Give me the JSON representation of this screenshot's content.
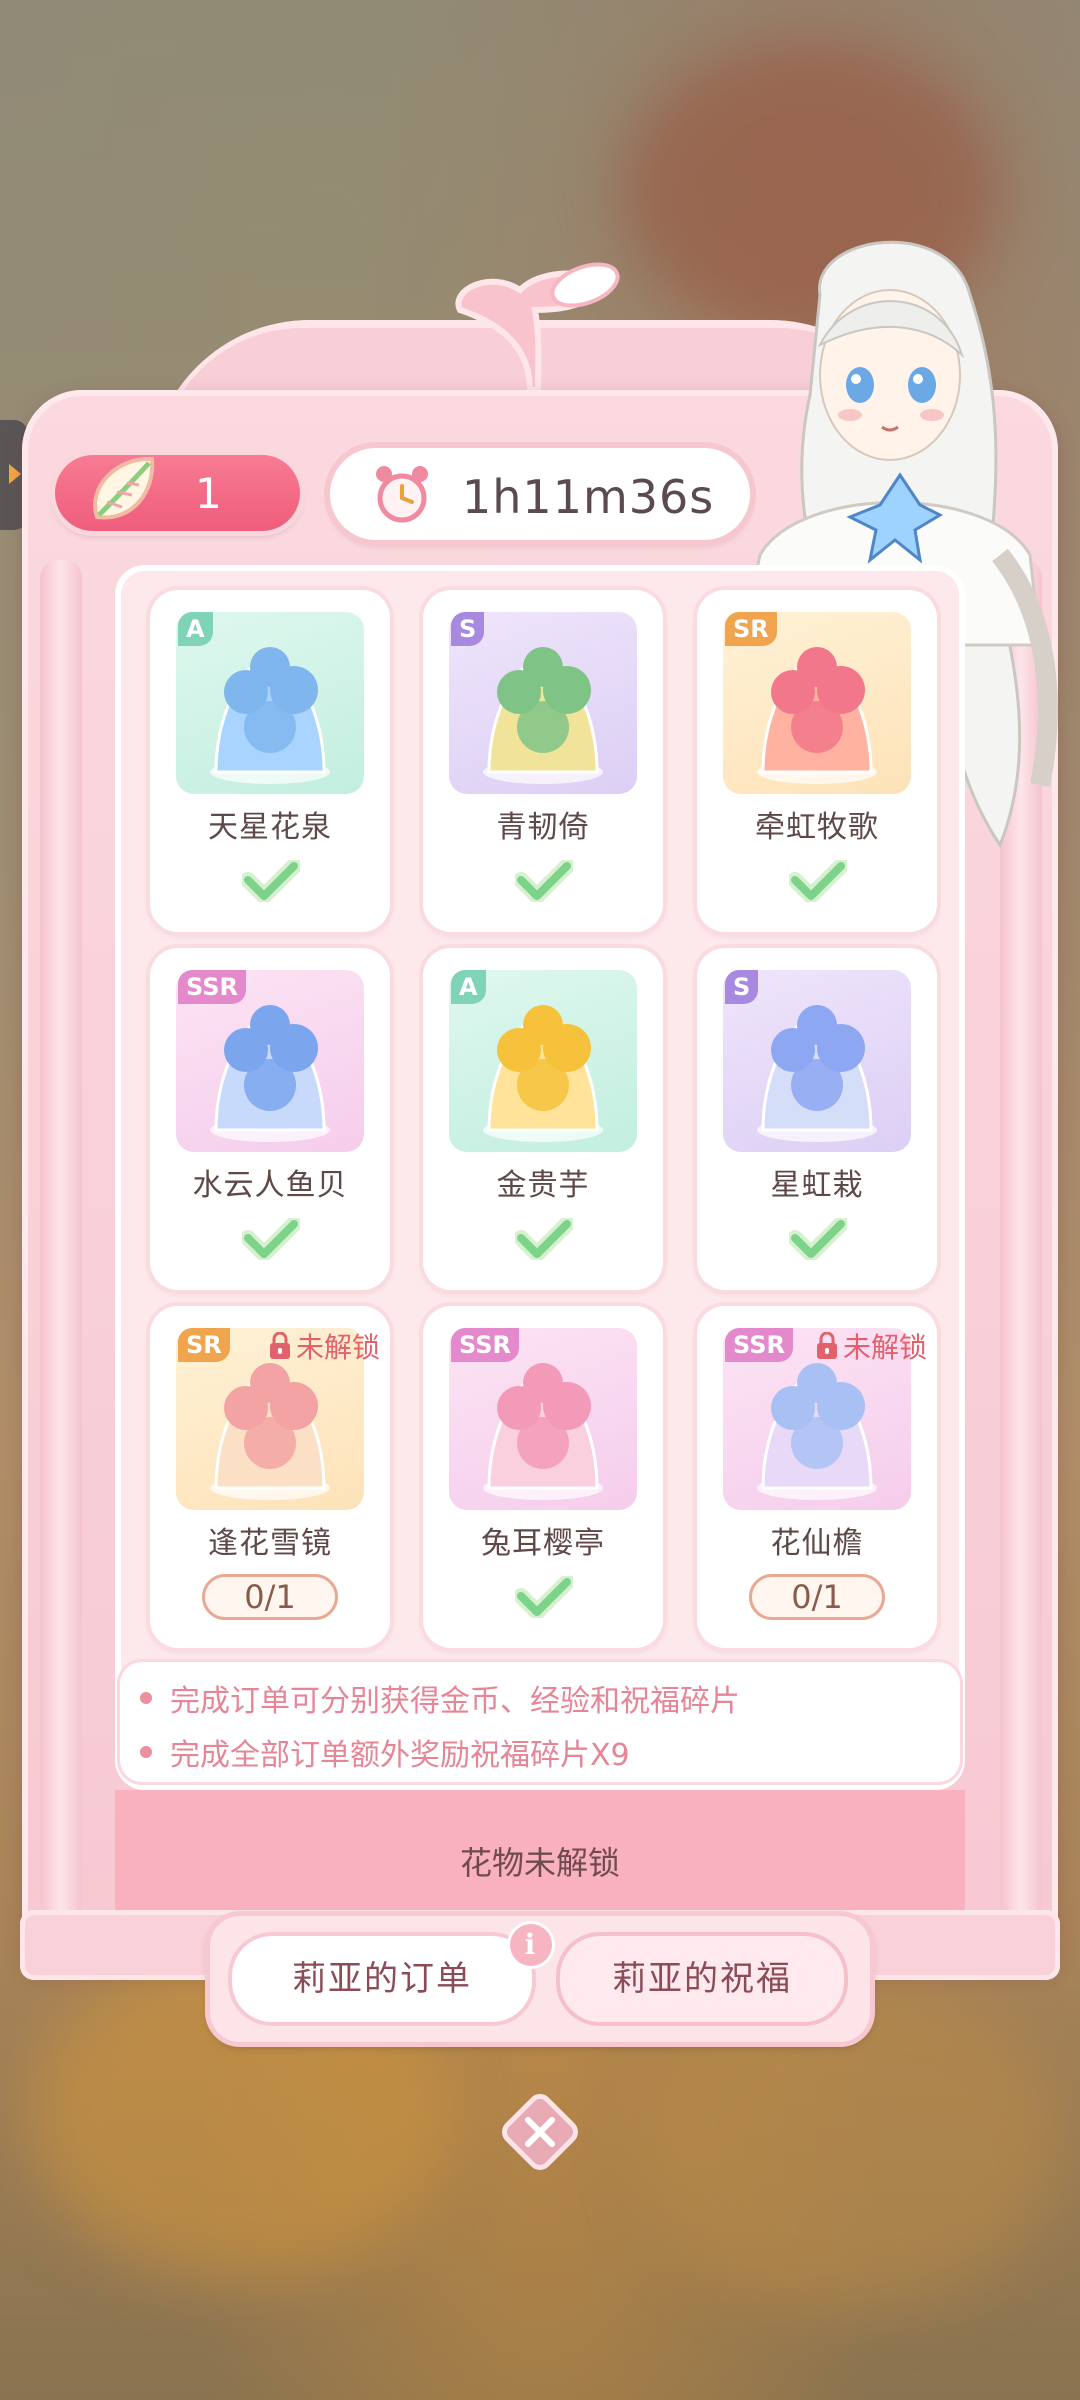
{
  "header": {
    "fragment_count": "1",
    "timer": "1h11m36s"
  },
  "items": [
    {
      "rarity": "A",
      "name": "天星花泉",
      "status": "done"
    },
    {
      "rarity": "S",
      "name": "青韧倚",
      "status": "done"
    },
    {
      "rarity": "SR",
      "name": "牵虹牧歌",
      "status": "done"
    },
    {
      "rarity": "SSR",
      "name": "水云人鱼贝",
      "status": "done"
    },
    {
      "rarity": "A",
      "name": "金贵芋",
      "status": "done"
    },
    {
      "rarity": "S",
      "name": "星虹栽",
      "status": "done"
    },
    {
      "rarity": "SR",
      "name": "逢花雪镜",
      "status": "locked",
      "lock_label": "未解锁",
      "progress": "0/1"
    },
    {
      "rarity": "SSR",
      "name": "兔耳樱亭",
      "status": "done"
    },
    {
      "rarity": "SSR",
      "name": "花仙檐",
      "status": "locked",
      "lock_label": "未解锁",
      "progress": "0/1"
    }
  ],
  "notes": [
    "完成订单可分别获得金币、经验和祝福碎片",
    "完成全部订单额外奖励祝福碎片X9"
  ],
  "status_text": "花物未解锁",
  "tabs": {
    "orders": "莉亚的订单",
    "blessing": "莉亚的祝福",
    "info_symbol": "i"
  },
  "colors": {
    "accent_pink": "#ef5d7c",
    "check_green": "#7ed38a",
    "note_pink": "#e58596"
  }
}
